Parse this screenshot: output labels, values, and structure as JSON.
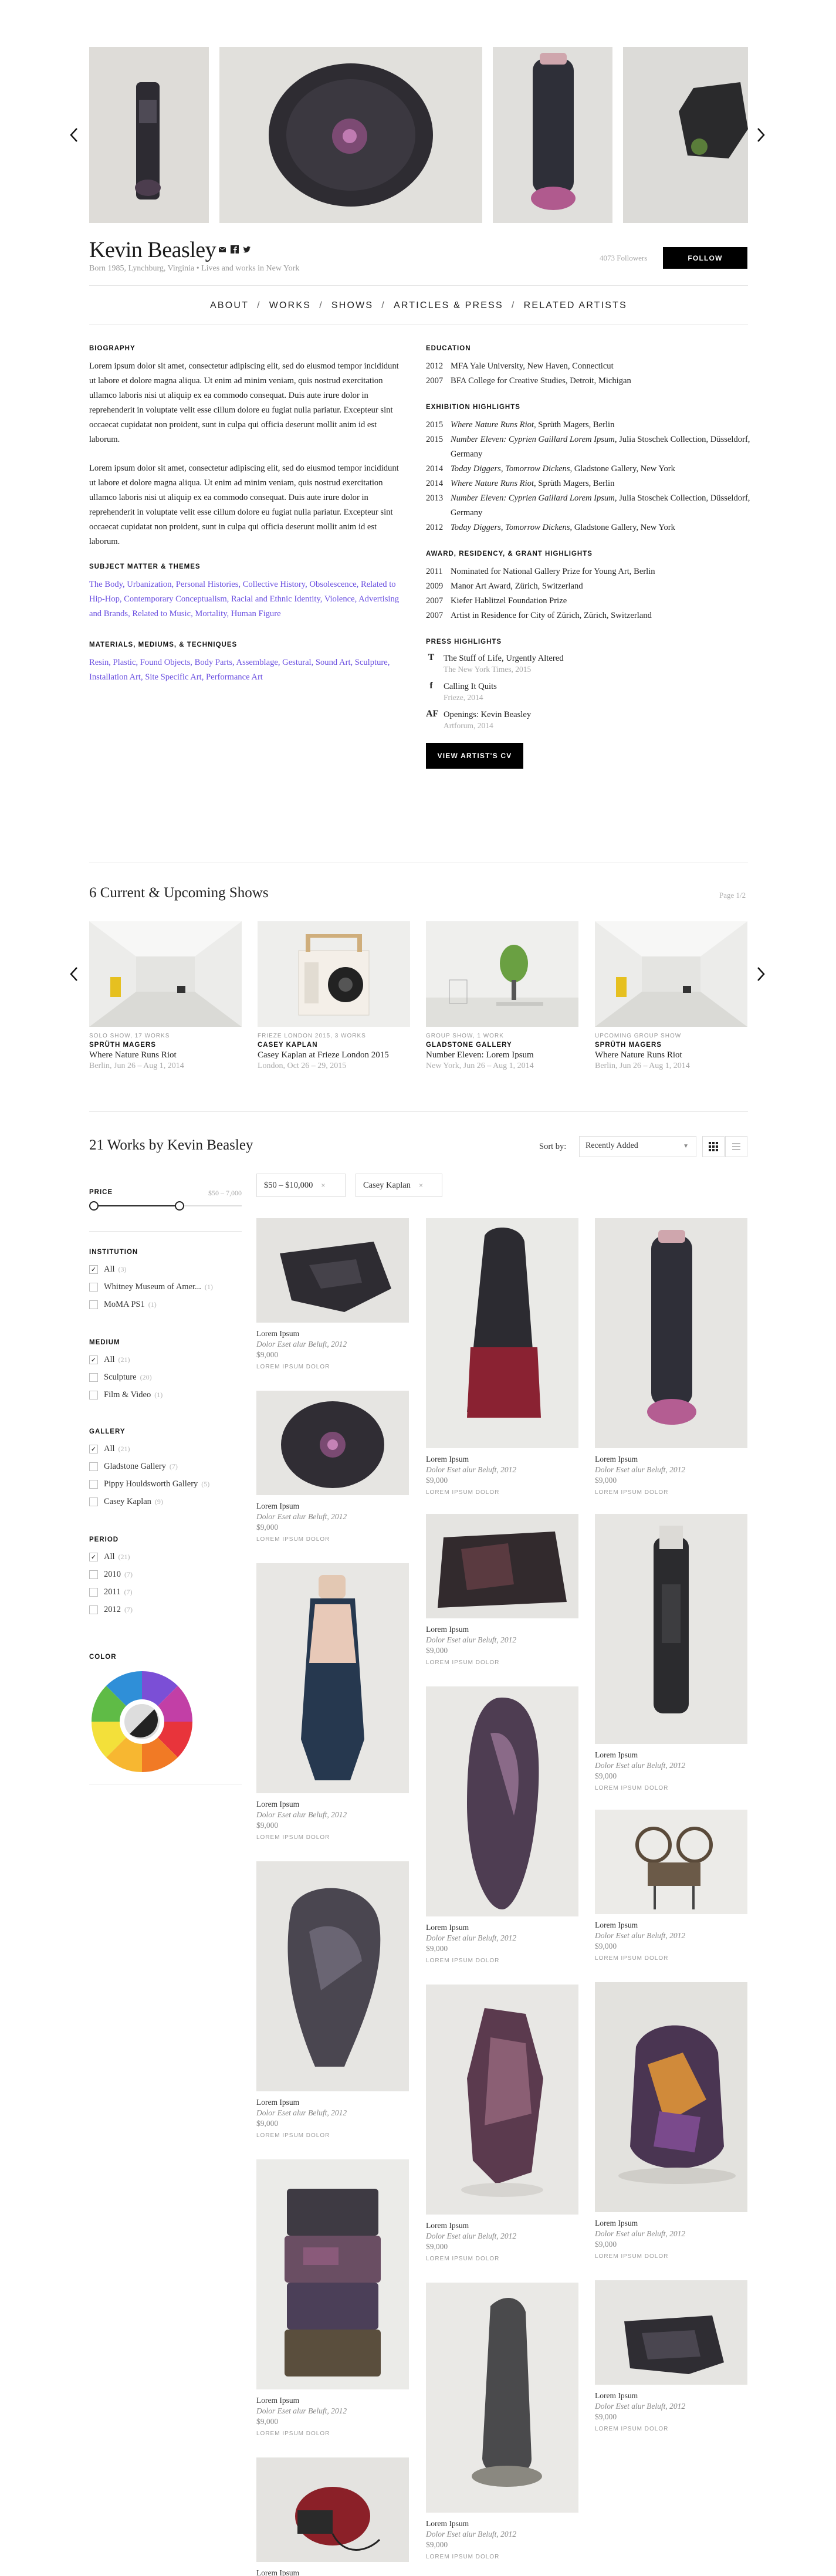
{
  "artist": {
    "name": "Kevin Beasley",
    "bio_line": "Born 1985, Lynchburg, Virginia • Lives and works in New York",
    "followers": "4073 Followers",
    "follow_label": "FOLLOW"
  },
  "nav": {
    "items": [
      "ABOUT",
      "WORKS",
      "SHOWS",
      "ARTICLES & PRESS",
      "RELATED ARTISTS"
    ],
    "separator": "/"
  },
  "biography": {
    "heading": "BIOGRAPHY",
    "paragraphs": [
      "Lorem ipsum dolor sit amet, consectetur adipiscing elit, sed do eiusmod tempor incididunt ut labore et dolore magna aliqua. Ut enim ad minim veniam, quis nostrud exercitation ullamco laboris nisi ut aliquip ex ea commodo consequat. Duis aute irure dolor in reprehenderit in voluptate velit esse cillum dolore eu fugiat nulla pariatur. Excepteur sint occaecat cupidatat non proident, sunt in culpa qui officia deserunt mollit anim id est laborum.",
      "Lorem ipsum dolor sit amet, consectetur adipiscing elit, sed do eiusmod tempor incididunt ut labore et dolore magna aliqua. Ut enim ad minim veniam, quis nostrud exercitation ullamco laboris nisi ut aliquip ex ea commodo consequat. Duis aute irure dolor in reprehenderit in voluptate velit esse cillum dolore eu fugiat nulla pariatur. Excepteur sint occaecat cupidatat non proident, sunt in culpa qui officia deserunt mollit anim id est laborum."
    ]
  },
  "subject_matter": {
    "heading": "SUBJECT MATTER & THEMES",
    "text": "The Body, Urbanization, Personal Histories, Collective History, Obsolescence, Related to Hip-Hop, Contemporary Conceptualism, Racial and Ethnic Identity, Violence, Advertising and Brands, Related to Music, Mortality, Human Figure"
  },
  "materials": {
    "heading": "MATERIALS, MEDIUMS, & TECHNIQUES",
    "text": "Resin, Plastic, Found Objects, Body Parts, Assemblage, Gestural, Sound Art, Sculpture, Installation Art, Site Specific Art, Performance Art"
  },
  "education": {
    "heading": "EDUCATION",
    "rows": [
      {
        "year": "2012",
        "text": "MFA Yale University, New Haven, Connecticut"
      },
      {
        "year": "2007",
        "text": "BFA College for Creative Studies, Detroit, Michigan"
      }
    ]
  },
  "exhibitions": {
    "heading": "EXHIBITION HIGHLIGHTS",
    "rows": [
      {
        "year": "2015",
        "title": "Where Nature Runs Riot",
        "rest": ", Sprüth Magers, Berlin"
      },
      {
        "year": "2015",
        "title": "Number Eleven: Cyprien Gaillard Lorem Ipsum",
        "rest": ", Julia Stoschek Collection, Düsseldorf, Germany"
      },
      {
        "year": "2014",
        "title": "Today Diggers, Tomorrow Dickens",
        "rest": ", Gladstone Gallery, New York"
      },
      {
        "year": "2014",
        "title": "Where Nature Runs Riot",
        "rest": ", Sprüth Magers, Berlin"
      },
      {
        "year": "2013",
        "title": "Number Eleven: Cyprien Gaillard Lorem Ipsum",
        "rest": ", Julia Stoschek Collection, Düsseldorf, Germany"
      },
      {
        "year": "2012",
        "title": "Today Diggers, Tomorrow Dickens",
        "rest": ", Gladstone Gallery, New York"
      }
    ]
  },
  "awards": {
    "heading": "AWARD, RESIDENCY, & GRANT HIGHLIGHTS",
    "rows": [
      {
        "year": "2011",
        "text": "Nominated for National Gallery Prize for Young Art, Berlin"
      },
      {
        "year": "2009",
        "text": "Manor Art Award, Zürich, Switzerland"
      },
      {
        "year": "2007",
        "text": "Kiefer Hablitzel Foundation Prize"
      },
      {
        "year": "2007",
        "text": "Artist in Residence for City of Zürich, Zürich, Switzerland"
      }
    ]
  },
  "press": {
    "heading": "PRESS HIGHLIGHTS",
    "items": [
      {
        "logo": "T",
        "title": "The Stuff of Life, Urgently Altered",
        "source": "The New York Times, 2015"
      },
      {
        "logo": "f",
        "title": "Calling It Quits",
        "source": "Frieze, 2014"
      },
      {
        "logo": "AF",
        "title": "Openings: Kevin Beasley",
        "source": "Artforum, 2014"
      }
    ],
    "cv_label": "VIEW ARTIST'S CV"
  },
  "shows": {
    "heading": "6 Current & Upcoming Shows",
    "page": "Page 1/2",
    "cards": [
      {
        "type": "SOLO SHOW, 17 WORKS",
        "gallery": "SPRÜTH MAGERS",
        "title": "Where Nature Runs Riot",
        "date": "Berlin, Jun 26 – Aug 1, 2014"
      },
      {
        "type": "FRIEZE LONDON 2015, 3 WORKS",
        "gallery": "CASEY KAPLAN",
        "title": "Casey Kaplan at Frieze London 2015",
        "date": "London, Oct 26 – 29, 2015"
      },
      {
        "type": "GROUP SHOW, 1 WORK",
        "gallery": "GLADSTONE GALLERY",
        "title": "Number Eleven: Lorem Ipsum",
        "date": "New York, Jun 26 – Aug 1, 2014"
      },
      {
        "type": "UPCOMING GROUP SHOW",
        "gallery": "SPRÜTH MAGERS",
        "title": "Where Nature Runs Riot",
        "date": "Berlin, Jun 26 – Aug 1, 2014"
      }
    ]
  },
  "works": {
    "heading": "21 Works by Kevin Beasley",
    "sort_label": "Sort by:",
    "sort_value": "Recently Added",
    "chips": [
      "$50 – $10,000",
      "Casey Kaplan"
    ],
    "chip_close": "×",
    "item": {
      "title": "Lorem Ipsum",
      "sub": "Dolor Eset alur Beluft, 2012",
      "price": "$9,000",
      "gallery": "LOREM IPSUM DOLOR"
    }
  },
  "filters": {
    "price": {
      "heading": "PRICE",
      "range": "$50 – 7,000"
    },
    "institution": {
      "heading": "INSTITUTION",
      "options": [
        {
          "label": "All",
          "count": "(3)",
          "checked": true
        },
        {
          "label": "Whitney Museum of Amer...",
          "count": "(1)",
          "checked": false
        },
        {
          "label": "MoMA PS1",
          "count": "(1)",
          "checked": false
        }
      ]
    },
    "medium": {
      "heading": "MEDIUM",
      "options": [
        {
          "label": "All",
          "count": "(21)",
          "checked": true
        },
        {
          "label": "Sculpture",
          "count": "(20)",
          "checked": false
        },
        {
          "label": "Film & Video",
          "count": "(1)",
          "checked": false
        }
      ]
    },
    "gallery": {
      "heading": "GALLERY",
      "options": [
        {
          "label": "All",
          "count": "(21)",
          "checked": true
        },
        {
          "label": "Gladstone Gallery",
          "count": "(7)",
          "checked": false
        },
        {
          "label": "Pippy Houldsworth Gallery",
          "count": "(5)",
          "checked": false
        },
        {
          "label": "Casey Kaplan",
          "count": "(9)",
          "checked": false
        }
      ]
    },
    "period": {
      "heading": "PERIOD",
      "options": [
        {
          "label": "All",
          "count": "(21)",
          "checked": true
        },
        {
          "label": "2010",
          "count": "(7)",
          "checked": false
        },
        {
          "label": "2011",
          "count": "(7)",
          "checked": false
        },
        {
          "label": "2012",
          "count": "(7)",
          "checked": false
        }
      ]
    },
    "color": {
      "heading": "COLOR"
    }
  },
  "colors": {
    "accent_link": "#6a4fe0",
    "button_bg": "#000000"
  }
}
